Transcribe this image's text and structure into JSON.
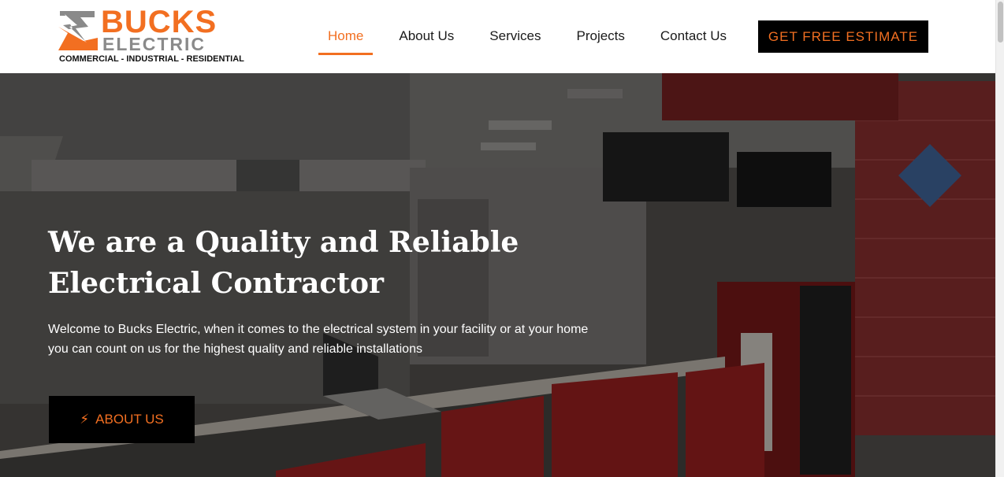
{
  "brand": {
    "name": "BUCKS",
    "sub": "ELECTRIC",
    "tagline": "COMMERCIAL - INDUSTRIAL - RESIDENTIAL",
    "icon": "lightning-bolt-icon",
    "accent_color": "#f26f21"
  },
  "nav": {
    "items": [
      {
        "label": "Home",
        "active": true
      },
      {
        "label": "About Us"
      },
      {
        "label": "Services"
      },
      {
        "label": "Projects"
      },
      {
        "label": "Contact Us"
      }
    ],
    "cta_label": "GET FREE ESTIMATE"
  },
  "hero": {
    "title_line1": "We are a Quality and Reliable",
    "title_line2": "Electrical Contractor",
    "text_line1": "Welcome to Bucks Electric, when it comes to the electrical system in your facility or at your home",
    "text_line2": "you can count on us for the highest quality and reliable installations",
    "button_label": "ABOUT US",
    "button_icon": "bolt-icon"
  }
}
